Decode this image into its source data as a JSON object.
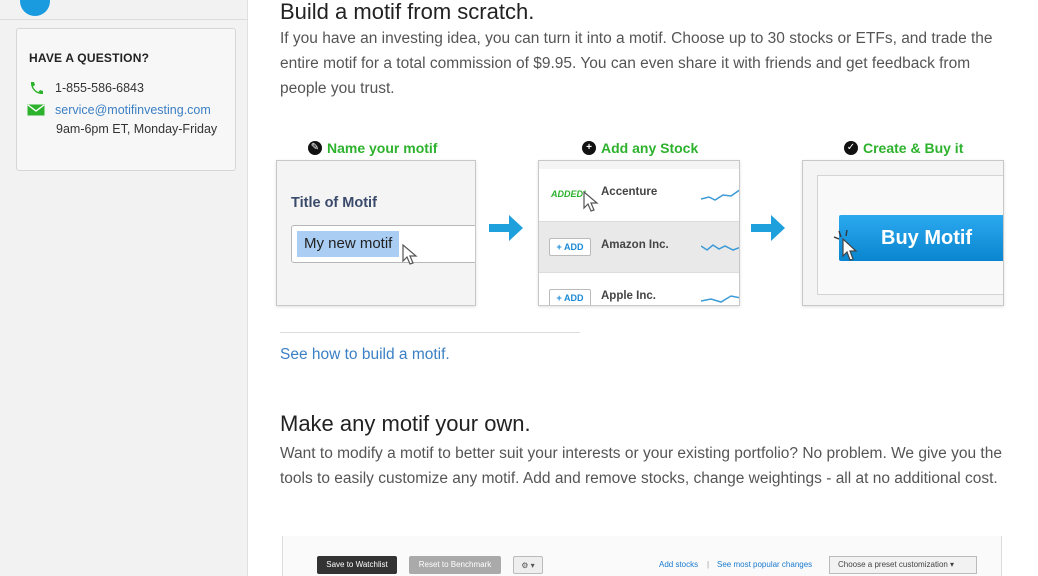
{
  "sidebar": {
    "question_title": "HAVE A QUESTION?",
    "phone": "1-855-586-6843",
    "email": "service@motifinvesting.com",
    "hours": "9am-6pm ET, Monday-Friday"
  },
  "section1": {
    "title": "Build a motif from scratch.",
    "paragraph": "If you have an investing idea, you can turn it into a motif. Choose up to 30 stocks or ETFs, and trade the entire motif for a total commission of $9.95. You can even share it with friends and get feedback from people you trust.",
    "steps": [
      {
        "label": "Name your motif",
        "icon": "✎"
      },
      {
        "label": "Add any Stock",
        "icon": "+"
      },
      {
        "label": "Create & Buy it",
        "icon": "✓"
      }
    ],
    "panel1": {
      "title": "Title of Motif",
      "input_value": "My new motif"
    },
    "panel2": {
      "added_tag": "ADDED!",
      "add_label": "+ ADD",
      "stocks": [
        "Accenture",
        "Amazon Inc.",
        "Apple Inc."
      ]
    },
    "panel3": {
      "buy_label": "Buy Motif"
    },
    "link": "See how to build a motif."
  },
  "section2": {
    "title": "Make any motif your own.",
    "paragraph": "Want to modify a motif to better suit your interests or your existing portfolio? No problem. We give you the tools to easily customize any motif. Add and remove stocks, change weightings - all at no additional cost."
  },
  "toolbar_preview": {
    "watchlist": "Save to Watchlist",
    "reset": "Reset to Benchmark",
    "gear": "⚙ ▾",
    "add_stocks": "Add stocks",
    "separator": "|",
    "popular": "See most popular changes",
    "preset": "Choose a preset customization ▾"
  },
  "colors": {
    "accent_green": "#2db22d",
    "link_blue": "#3b7fc4",
    "button_blue": "#1a9be0"
  }
}
